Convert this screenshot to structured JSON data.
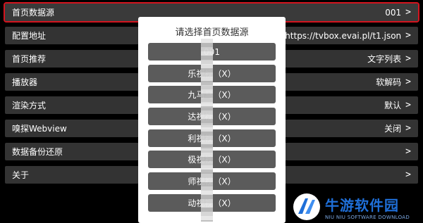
{
  "settings": [
    {
      "label": "首页数据源",
      "value": "001",
      "chevron": ">"
    },
    {
      "label": "配置地址",
      "value": "https://tvbox.evai.pl/t1.json",
      "chevron": ">"
    },
    {
      "label": "首页推荐",
      "value": "文字列表",
      "chevron": ">"
    },
    {
      "label": "播放器",
      "value": "软解码",
      "chevron": ">"
    },
    {
      "label": "渲染方式",
      "value": "默认",
      "chevron": ">"
    },
    {
      "label": "嗅探Webview",
      "value": "关闭",
      "chevron": ">"
    },
    {
      "label": "数据备份还原",
      "value": "",
      "chevron": ">"
    },
    {
      "label": "关于",
      "value": "",
      "chevron": ">"
    }
  ],
  "dialog": {
    "title": "请选择首页数据源",
    "options": [
      "001",
      "乐视视（X）",
      "九马马（X）",
      "达视视（X）",
      "利视视（X）",
      "极视视（X）",
      "师视视（X）",
      "动视视（X）"
    ]
  },
  "watermark": {
    "title": "牛游软件园",
    "subtitle": "NIU NIU SOFTWARE DOWNLOAD"
  },
  "colors": {
    "selection": "#d4141e",
    "row_bg": "#333333",
    "option_bg": "#5b5b5b",
    "brand": "#1f6fd8"
  }
}
